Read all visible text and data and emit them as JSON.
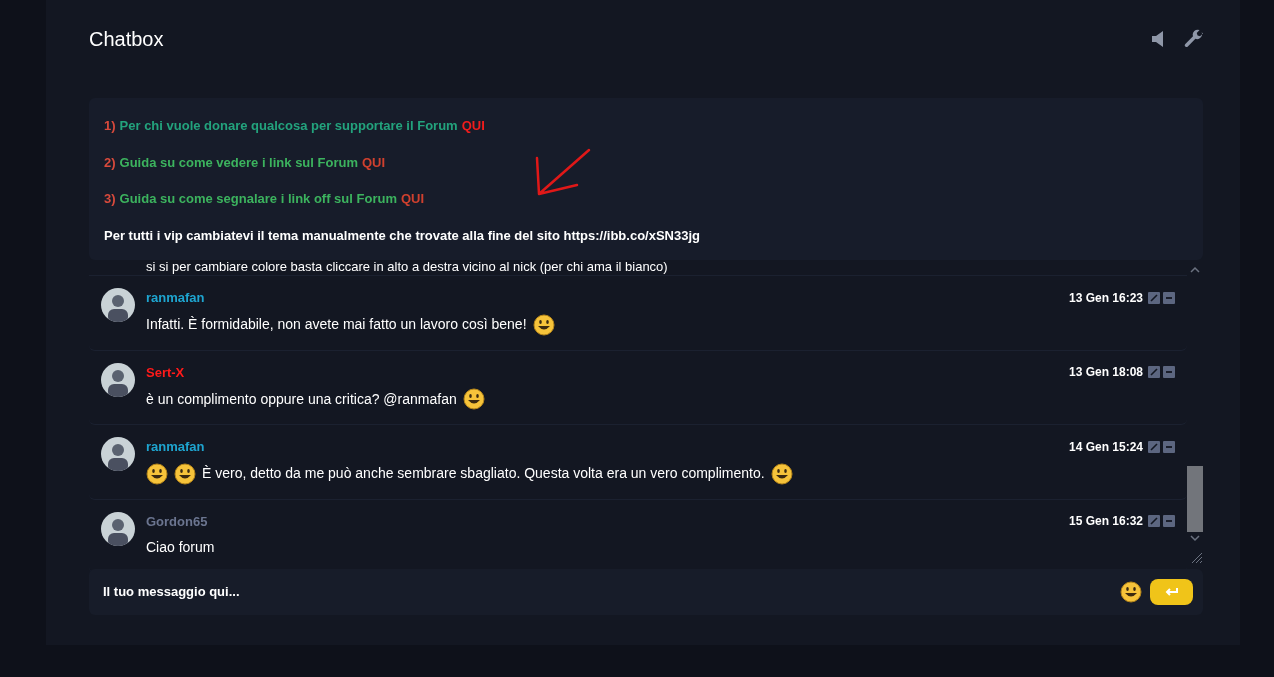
{
  "title": "Chatbox",
  "notice": {
    "lines": [
      {
        "number": "1)",
        "text": "Per chi vuole donare qualcosa per supportare il Forum",
        "link": "QUI"
      },
      {
        "number": "2)",
        "text": "Guida su come vedere i link sul Forum",
        "link": "QUI"
      },
      {
        "number": "3)",
        "text": "Guida su come segnalare i link off sul Forum",
        "link": "QUI"
      }
    ],
    "footer": "Per tutti i vip cambiatevi il tema manualmente che trovate alla fine del sito https://ibb.co/xSN33jg"
  },
  "partial_message": "si si per cambiare colore basta cliccare in alto a destra vicino al nick (per chi ama il bianco)",
  "messages": [
    {
      "author": "ranmafan",
      "color": "#1ea5d0",
      "time": "13 Gen 16:23",
      "parts": [
        {
          "kind": "text",
          "text": "Infatti. È formidabile, non avete mai fatto un lavoro così bene!"
        },
        {
          "kind": "emoji"
        }
      ]
    },
    {
      "author": "Sert-X",
      "color": "#ff1a1a",
      "time": "13 Gen 18:08",
      "parts": [
        {
          "kind": "text",
          "text": "è un complimento oppure una critica? @ranmafan"
        },
        {
          "kind": "emoji"
        }
      ]
    },
    {
      "author": "ranmafan",
      "color": "#1ea5d0",
      "time": "14 Gen 15:24",
      "parts": [
        {
          "kind": "emoji"
        },
        {
          "kind": "emoji"
        },
        {
          "kind": "text",
          "text": "È vero, detto da me può anche sembrare sbagliato. Questa volta era un vero complimento."
        },
        {
          "kind": "emoji"
        }
      ]
    },
    {
      "author": "Gordon65",
      "color": "#6b7590",
      "time": "15 Gen 16:32",
      "parts": [
        {
          "kind": "text",
          "text": "Ciao forum"
        }
      ]
    }
  ],
  "input": {
    "placeholder": "Il tuo messaggio qui..."
  }
}
